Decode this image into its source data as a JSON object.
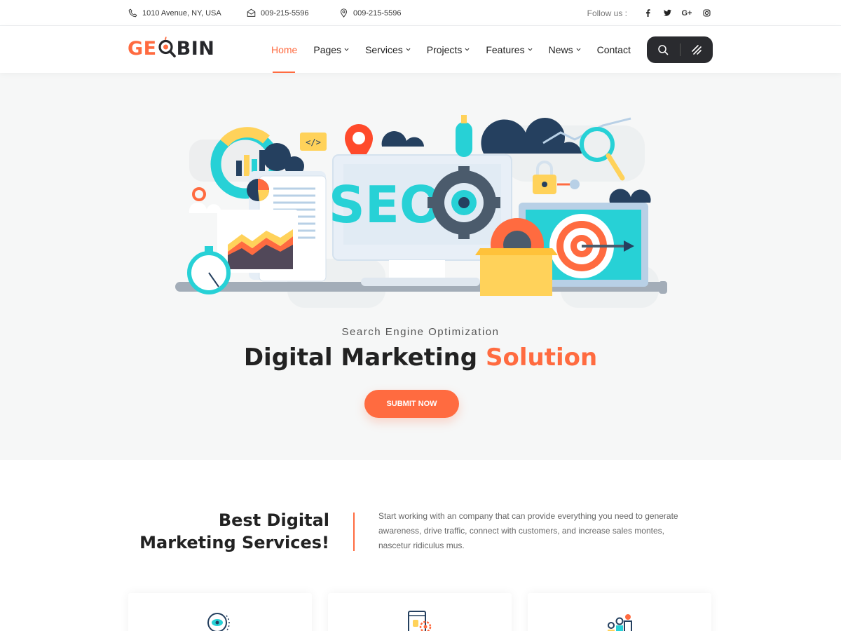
{
  "topbar": {
    "address": "1010 Avenue, NY, USA",
    "phone1": "009-215-5596",
    "phone2": "009-215-5596",
    "follow_label": "Follow us :",
    "social": [
      "facebook-icon",
      "twitter-icon",
      "google-plus-icon",
      "instagram-icon"
    ],
    "google_plus_text": "G+"
  },
  "logo": {
    "part1": "GE",
    "part2": "BIN"
  },
  "nav": {
    "items": [
      {
        "label": "Home",
        "active": true,
        "dropdown": false
      },
      {
        "label": "Pages",
        "dropdown": true
      },
      {
        "label": "Services",
        "dropdown": true
      },
      {
        "label": "Projects",
        "dropdown": true
      },
      {
        "label": "Features",
        "dropdown": true
      },
      {
        "label": "News",
        "dropdown": true
      },
      {
        "label": "Contact",
        "dropdown": false
      }
    ]
  },
  "hero": {
    "subtitle": "Search Engine Optimization",
    "title_main": "Digital Marketing",
    "title_accent": "Solution",
    "button_label": "SUBMIT NOW",
    "art_text": "SEO"
  },
  "services": {
    "title_line1": "Best Digital",
    "title_line2": "Marketing Services!",
    "description": "Start working with an company that can provide everything you need to generate awareness, drive traffic, connect with customers, and increase sales montes, nascetur ridiculus mus."
  },
  "colors": {
    "accent": "#ff6b40",
    "dark": "#26272b",
    "teal": "#27d1d6",
    "navy": "#25405f",
    "yellow": "#ffd25a",
    "hero_bg": "#f6f7f7"
  }
}
